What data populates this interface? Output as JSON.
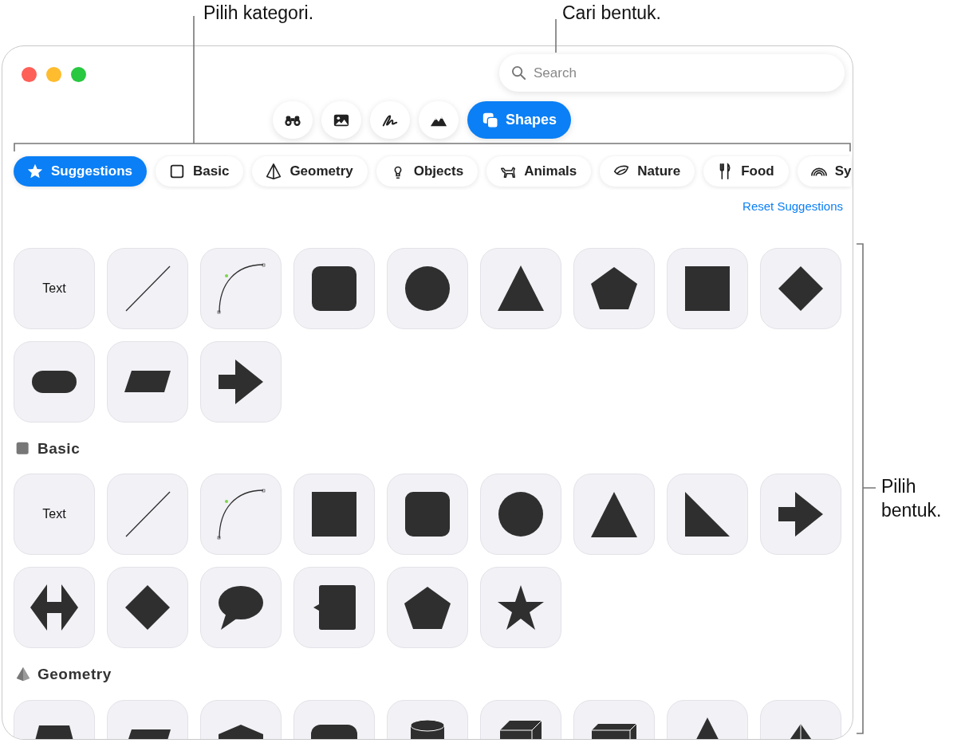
{
  "callouts": [
    {
      "text": "Pilih kategori."
    },
    {
      "text": "Cari bentuk."
    },
    {
      "text": "Pilih bentuk."
    }
  ],
  "window": {
    "search": {
      "placeholder": "Search"
    },
    "tools": [
      {
        "selected": false
      },
      {
        "selected": false
      },
      {
        "selected": false
      },
      {
        "selected": false
      },
      {
        "label": "Shapes",
        "selected": true
      }
    ],
    "categories": [
      {
        "label": "Suggestions",
        "selected": true
      },
      {
        "label": "Basic",
        "selected": false
      },
      {
        "label": "Geometry",
        "selected": false
      },
      {
        "label": "Objects",
        "selected": false
      },
      {
        "label": "Animals",
        "selected": false
      },
      {
        "label": "Nature",
        "selected": false
      },
      {
        "label": "Food",
        "selected": false
      },
      {
        "label": "Sy",
        "selected": false
      }
    ],
    "reset_link": "Reset Suggestions",
    "sections": [
      {
        "shapes": [
          {
            "kind": "text",
            "label": "Text"
          },
          {
            "kind": "line"
          },
          {
            "kind": "curve"
          },
          {
            "kind": "rounded-square"
          },
          {
            "kind": "circle"
          },
          {
            "kind": "triangle"
          },
          {
            "kind": "pentagon"
          },
          {
            "kind": "square"
          },
          {
            "kind": "diamond"
          },
          {
            "kind": "pill"
          },
          {
            "kind": "parallelogram"
          },
          {
            "kind": "arrow"
          }
        ]
      },
      {
        "title": "Basic",
        "shapes": [
          {
            "kind": "text",
            "label": "Text"
          },
          {
            "kind": "line"
          },
          {
            "kind": "curve"
          },
          {
            "kind": "square"
          },
          {
            "kind": "rounded-square"
          },
          {
            "kind": "circle"
          },
          {
            "kind": "triangle"
          },
          {
            "kind": "right-triangle"
          },
          {
            "kind": "arrow"
          },
          {
            "kind": "double-arrow"
          },
          {
            "kind": "diamond"
          },
          {
            "kind": "speech-bubble"
          },
          {
            "kind": "callout"
          },
          {
            "kind": "pentagon"
          },
          {
            "kind": "star"
          }
        ]
      },
      {
        "title": "Geometry",
        "shapes": [
          {
            "kind": "trapezoid"
          },
          {
            "kind": "parallelogram"
          },
          {
            "kind": "hexagon"
          },
          {
            "kind": "rounded-rectangle"
          },
          {
            "kind": "cylinder"
          },
          {
            "kind": "cube"
          },
          {
            "kind": "box"
          },
          {
            "kind": "triangle"
          },
          {
            "kind": "pyramid"
          }
        ]
      }
    ]
  }
}
